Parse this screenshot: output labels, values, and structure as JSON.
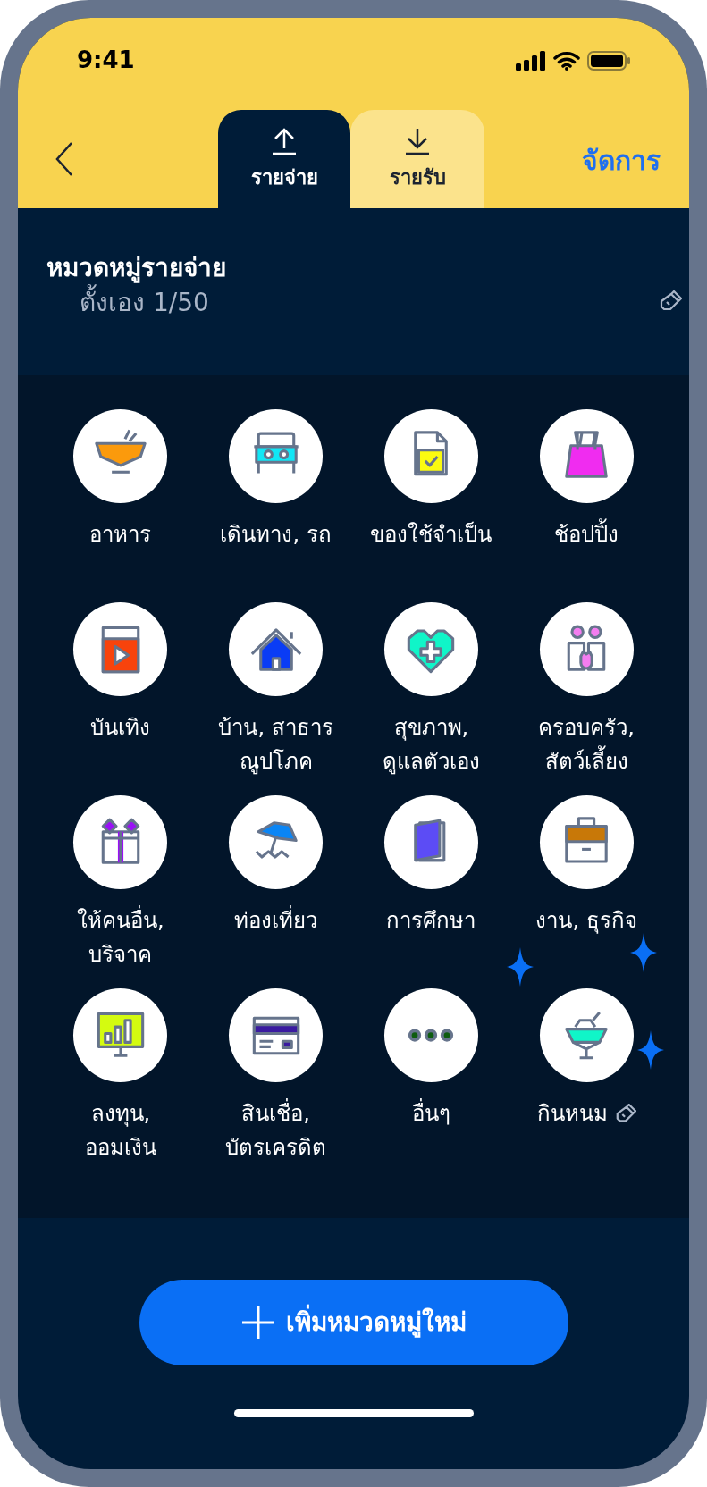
{
  "status_bar": {
    "time": "9:41"
  },
  "header": {
    "manage_label": "จัดการ"
  },
  "tabs": [
    {
      "label": "รายจ่าย",
      "kind": "upload",
      "selected": true
    },
    {
      "label": "รายรับ",
      "kind": "download",
      "selected": false
    }
  ],
  "section": {
    "title": "หมวดหมู่รายจ่าย",
    "subtitle": "ตั้งเอง 1/50"
  },
  "categories": [
    {
      "lines": [
        "อาหาร"
      ],
      "kind": "bowl",
      "custom": false
    },
    {
      "lines": [
        "เดินทาง, รถ"
      ],
      "kind": "car",
      "custom": false
    },
    {
      "lines": [
        "ของใช้จำเป็น"
      ],
      "kind": "document",
      "custom": false
    },
    {
      "lines": [
        "ช้อปปิ้ง"
      ],
      "kind": "bag",
      "custom": false
    },
    {
      "lines": [
        "บันเทิง"
      ],
      "kind": "video",
      "custom": false
    },
    {
      "lines": [
        "บ้าน, สาธาร",
        "ณูปโภค"
      ],
      "kind": "house",
      "custom": false
    },
    {
      "lines": [
        "สุขภาพ,",
        "ดูแลตัวเอง"
      ],
      "kind": "heart",
      "custom": false
    },
    {
      "lines": [
        "ครอบครัว,",
        "สัตว์เลี้ยง"
      ],
      "kind": "family",
      "custom": false
    },
    {
      "lines": [
        "ให้คนอื่น,",
        "บริจาค"
      ],
      "kind": "gift",
      "custom": false
    },
    {
      "lines": [
        "ท่องเที่ยว"
      ],
      "kind": "umbrella",
      "custom": false
    },
    {
      "lines": [
        "การศึกษา"
      ],
      "kind": "book",
      "custom": false
    },
    {
      "lines": [
        "งาน, ธุรกิจ"
      ],
      "kind": "briefcase",
      "custom": false
    },
    {
      "lines": [
        "ลงทุน,",
        "ออมเงิน"
      ],
      "kind": "chart",
      "custom": false
    },
    {
      "lines": [
        "สินเชื่อ,",
        "บัตรเครดิต"
      ],
      "kind": "card",
      "custom": false
    },
    {
      "lines": [
        "อื่นๆ"
      ],
      "kind": "dots",
      "custom": false
    },
    {
      "lines": [
        "กินหนม"
      ],
      "kind": "dessert",
      "custom": true
    }
  ],
  "add_button": {
    "label": "เพิ่มหมวดหมู่ใหม่"
  }
}
